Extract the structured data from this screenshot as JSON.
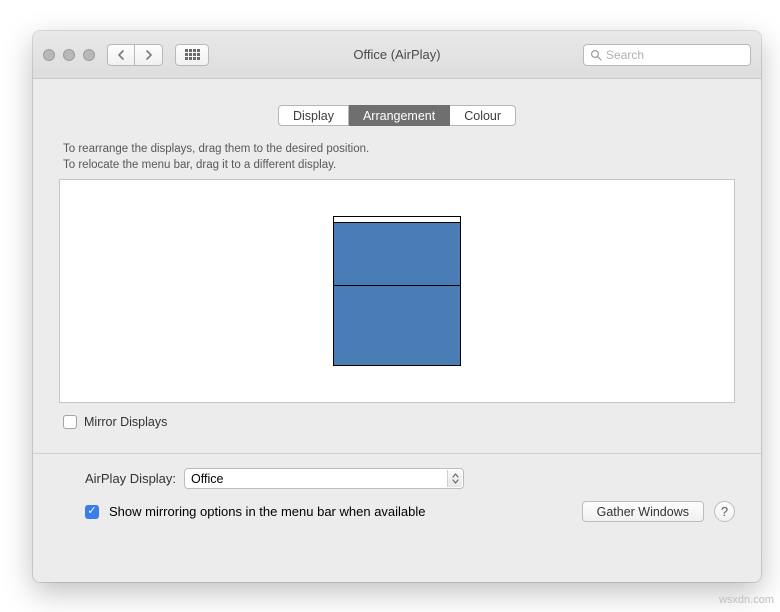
{
  "window": {
    "title": "Office (AirPlay)"
  },
  "search": {
    "placeholder": "Search"
  },
  "tabs": {
    "display": "Display",
    "arrangement": "Arrangement",
    "colour": "Colour"
  },
  "instructions": {
    "line1": "To rearrange the displays, drag them to the desired position.",
    "line2": "To relocate the menu bar, drag it to a different display."
  },
  "mirror": {
    "label": "Mirror Displays"
  },
  "airplay": {
    "label": "AirPlay Display:",
    "value": "Office"
  },
  "show_mirroring": {
    "label": "Show mirroring options in the menu bar when available"
  },
  "buttons": {
    "gather": "Gather Windows",
    "help": "?"
  },
  "watermark": "wsxdn.com"
}
